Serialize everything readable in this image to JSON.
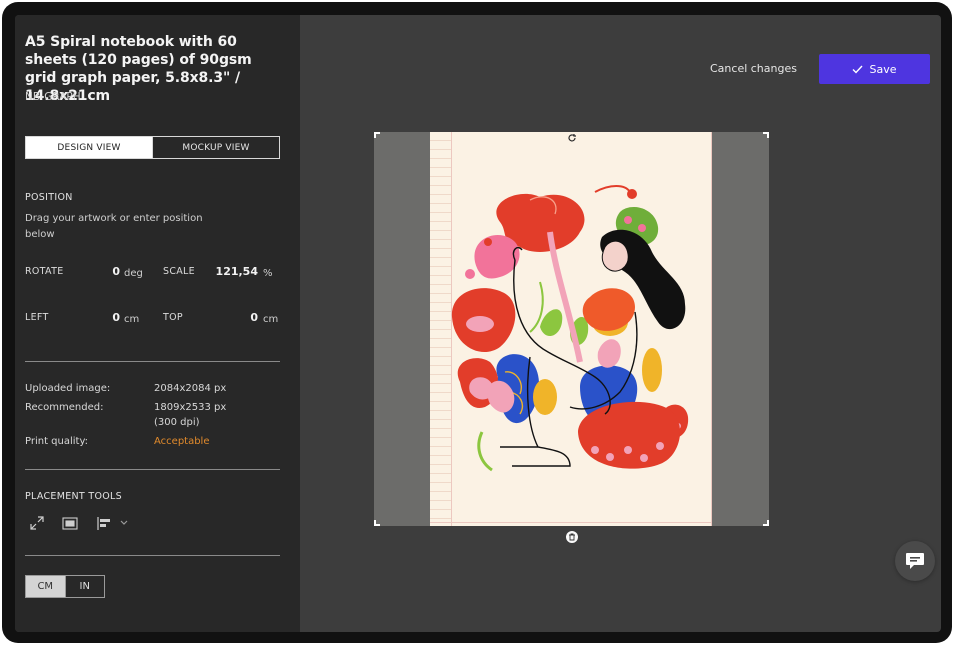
{
  "product": {
    "title": "A5 Spiral notebook with 60 sheets (120 pages) of 90gsm grid graph paper, 5.8x8.3\" / 14.8x21cm",
    "sku": "NB-GRAPH"
  },
  "views": {
    "design": "DESIGN VIEW",
    "mockup": "MOCKUP VIEW",
    "selected": "DESIGN VIEW"
  },
  "position": {
    "heading": "POSITION",
    "hint": "Drag your artwork or enter position below",
    "rotate": {
      "label": "ROTATE",
      "value": "0",
      "unit": "deg"
    },
    "scale": {
      "label": "SCALE",
      "value": "121,54",
      "unit": "%"
    },
    "left": {
      "label": "LEFT",
      "value": "0",
      "unit": "cm"
    },
    "top": {
      "label": "TOP",
      "value": "0",
      "unit": "cm"
    }
  },
  "image_info": {
    "uploaded_label": "Uploaded image:",
    "uploaded_value": "2084x2084 px",
    "recommended_label": "Recommended:",
    "recommended_value": "1809x2533 px",
    "recommended_dpi": "(300 dpi)",
    "quality_label": "Print quality:",
    "quality_value": "Acceptable",
    "quality_color": "#e08a2c"
  },
  "placement_tools": {
    "heading": "PLACEMENT TOOLS",
    "tools": [
      "expand-icon",
      "fit-icon",
      "align-left-icon"
    ]
  },
  "units": {
    "cm": "CM",
    "in": "IN",
    "selected": "CM"
  },
  "actions": {
    "cancel": "Cancel changes",
    "save": "Save"
  },
  "colors": {
    "accent": "#4e35e0",
    "sidebar": "#282828",
    "workspace": "#3d3d3d"
  }
}
